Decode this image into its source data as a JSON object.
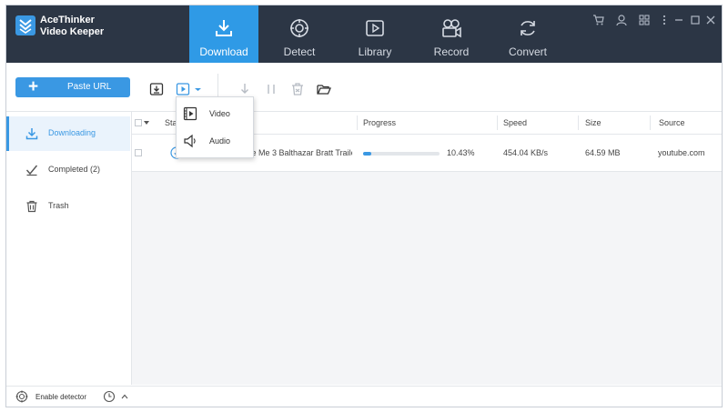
{
  "app": {
    "name_line1": "AceThinker",
    "name_line2": "Video Keeper"
  },
  "nav": [
    {
      "label": "Download",
      "icon": "download-icon",
      "active": true
    },
    {
      "label": "Detect",
      "icon": "detect-icon",
      "active": false
    },
    {
      "label": "Library",
      "icon": "library-icon",
      "active": false
    },
    {
      "label": "Record",
      "icon": "record-icon",
      "active": false
    },
    {
      "label": "Convert",
      "icon": "convert-icon",
      "active": false
    }
  ],
  "colors": {
    "titlebar": "#2c3645",
    "accent": "#3a98e3",
    "active_tab": "#2f9ae6"
  },
  "toolbar": {
    "paste_url_label": "Paste URL"
  },
  "dropdown": {
    "items": [
      {
        "label": "Video",
        "icon": "video-file-icon"
      },
      {
        "label": "Audio",
        "icon": "audio-speaker-icon"
      }
    ]
  },
  "sidebar": {
    "items": [
      {
        "label": "Downloading",
        "icon": "download-icon",
        "active": true
      },
      {
        "label": "Completed (2)",
        "icon": "completed-check-icon",
        "active": false
      },
      {
        "label": "Trash",
        "icon": "trash-icon",
        "active": false
      }
    ]
  },
  "table": {
    "headers": {
      "status": "Stat",
      "name": "e",
      "progress": "Progress",
      "speed": "Speed",
      "size": "Size",
      "source": "Source"
    },
    "rows": [
      {
        "name": "Despicable Me 3 Balthazar Bratt Traile...",
        "progress": 0.1043,
        "progress_text": "10.43%",
        "speed": "454.04 KB/s",
        "size": "64.59 MB",
        "source": "youtube.com"
      }
    ]
  },
  "status_bar": {
    "enable_detector_label": "Enable detector"
  }
}
